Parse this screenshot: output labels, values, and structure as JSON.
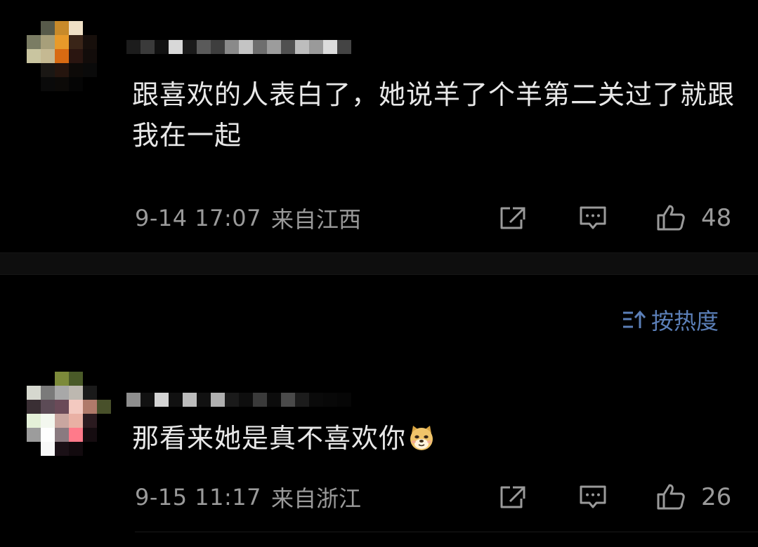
{
  "colors": {
    "background": "#000000",
    "text_primary": "#e8e8e8",
    "text_secondary": "#9a9a9a",
    "accent_blue": "#5b7fb8"
  },
  "comments": [
    {
      "username_blurred": true,
      "text": "跟喜欢的人表白了，她说羊了个羊第二关过了就跟我在一起",
      "time": "9-14 17:07",
      "location": "来自江西",
      "likes": "48",
      "icons": {
        "share": "share-icon",
        "comment": "comment-icon",
        "like": "thumbs-up-icon"
      }
    },
    {
      "username_blurred": true,
      "text": "那看来她是真不喜欢你",
      "emoji": "doge-emoji",
      "time": "9-15 11:17",
      "location": "来自浙江",
      "likes": "26",
      "icons": {
        "share": "share-icon",
        "comment": "comment-icon",
        "like": "thumbs-up-icon"
      }
    }
  ],
  "sort": {
    "label": "按热度",
    "icon": "sort-icon"
  }
}
